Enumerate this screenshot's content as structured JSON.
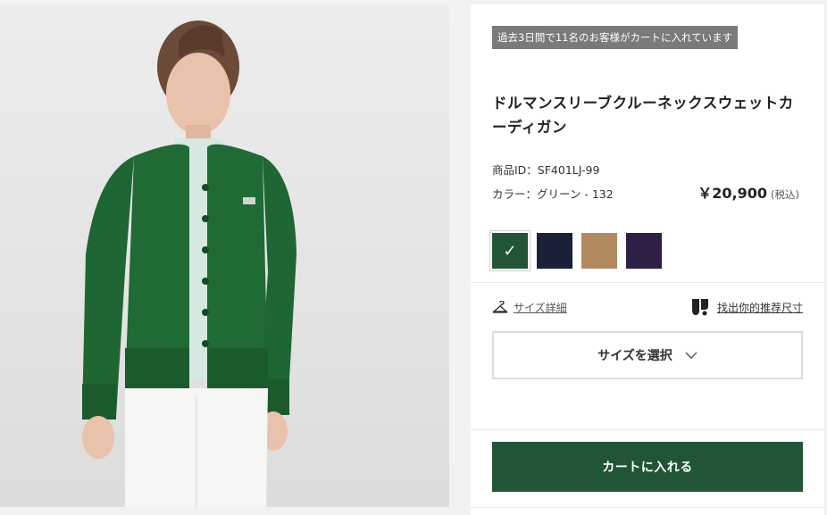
{
  "product": {
    "social_proof": "過去3日間で11名のお客様がカートに入れています",
    "title": "ドルマンスリーブクルーネックスウェットカーディガン",
    "product_id_label": "商品ID：SF401LJ-99",
    "color_label": "カラー：グリーン - 132",
    "price": "￥20,900",
    "price_tax_note": "(税込)",
    "swatches": [
      {
        "name": "green",
        "color": "#205636",
        "selected": true
      },
      {
        "name": "navy",
        "color": "#1a2035",
        "selected": false
      },
      {
        "name": "beige",
        "color": "#b08a5e",
        "selected": false
      },
      {
        "name": "purple",
        "color": "#2e1f45",
        "selected": false
      }
    ],
    "check_glyph": "✓"
  },
  "links": {
    "size_detail": "サイズ詳細",
    "fit_finder": "找出你的推荐尺寸"
  },
  "actions": {
    "size_select_label": "サイズを選択",
    "chevron": "⌵",
    "add_to_cart": "カートに入れる"
  },
  "colors": {
    "accent_green": "#205636",
    "badge_gray": "#7a7a7a"
  }
}
